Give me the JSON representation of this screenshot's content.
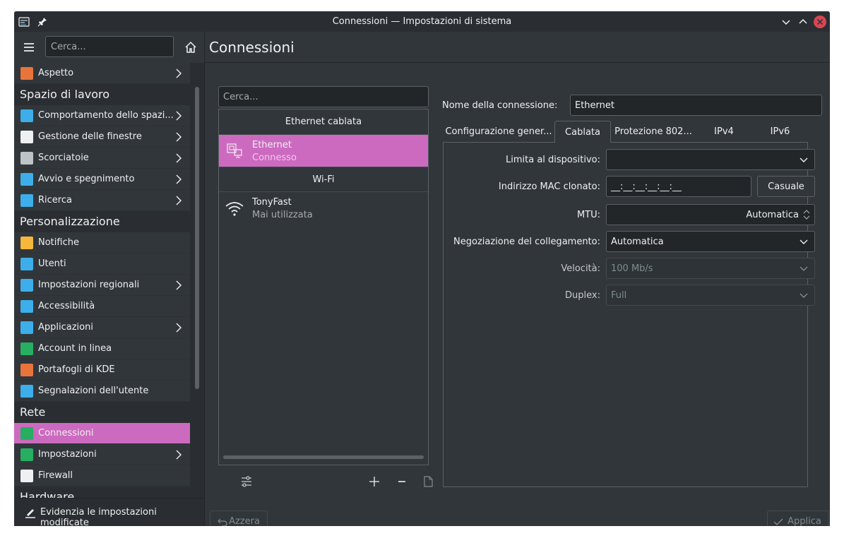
{
  "window": {
    "title": "Connessioni — Impostazioni di sistema"
  },
  "sidebar": {
    "search_placeholder": "Cerca...",
    "items": [
      {
        "type": "item",
        "label": "Aspetto",
        "icon": "appearance-icon",
        "color": "#e8743b",
        "chevron": true
      },
      {
        "type": "category",
        "label": "Spazio di lavoro"
      },
      {
        "type": "item",
        "label": "Comportamento dello spazi...",
        "icon": "workspace-behavior-icon",
        "color": "#3daee9",
        "chevron": true
      },
      {
        "type": "item",
        "label": "Gestione delle finestre",
        "icon": "window-management-icon",
        "color": "#eff0f1",
        "chevron": true
      },
      {
        "type": "item",
        "label": "Scorciatoie",
        "icon": "keyboard-icon",
        "color": "#bdc3c7",
        "chevron": true
      },
      {
        "type": "item",
        "label": "Avvio e spegnimento",
        "icon": "startup-icon",
        "color": "#3daee9",
        "chevron": true
      },
      {
        "type": "item",
        "label": "Ricerca",
        "icon": "search-icon",
        "color": "#3daee9",
        "chevron": true
      },
      {
        "type": "category",
        "label": "Personalizzazione"
      },
      {
        "type": "item",
        "label": "Notifiche",
        "icon": "bell-icon",
        "color": "#f6b73c",
        "chevron": false
      },
      {
        "type": "item",
        "label": "Utenti",
        "icon": "users-icon",
        "color": "#3daee9",
        "chevron": false
      },
      {
        "type": "item",
        "label": "Impostazioni regionali",
        "icon": "regional-icon",
        "color": "#3daee9",
        "chevron": true
      },
      {
        "type": "item",
        "label": "Accessibilità",
        "icon": "accessibility-icon",
        "color": "#3daee9",
        "chevron": false
      },
      {
        "type": "item",
        "label": "Applicazioni",
        "icon": "applications-icon",
        "color": "#3daee9",
        "chevron": true
      },
      {
        "type": "item",
        "label": "Account in linea",
        "icon": "globe-icon",
        "color": "#27ae60",
        "chevron": false
      },
      {
        "type": "item",
        "label": "Portafogli di KDE",
        "icon": "wallet-icon",
        "color": "#e8743b",
        "chevron": false
      },
      {
        "type": "item",
        "label": "Segnalazioni dell'utente",
        "icon": "feedback-icon",
        "color": "#3daee9",
        "chevron": false
      },
      {
        "type": "category",
        "label": "Rete"
      },
      {
        "type": "item",
        "label": "Connessioni",
        "icon": "globe-icon",
        "color": "#27ae60",
        "chevron": false,
        "selected": true
      },
      {
        "type": "item",
        "label": "Impostazioni",
        "icon": "globe-icon",
        "color": "#27ae60",
        "chevron": true
      },
      {
        "type": "item",
        "label": "Firewall",
        "icon": "shield-icon",
        "color": "#eff0f1",
        "chevron": false
      },
      {
        "type": "category",
        "label": "Hardware"
      }
    ],
    "footer_label": "Evidenzia le impostazioni modificate"
  },
  "main": {
    "page_title": "Connessioni",
    "search_placeholder": "Cerca...",
    "groups": [
      {
        "label": "Ethernet cablata",
        "connections": [
          {
            "name": "Ethernet",
            "status": "Connesso",
            "selected": true,
            "icon": "wired-network-icon"
          }
        ]
      },
      {
        "label": "Wi-Fi",
        "connections": [
          {
            "name": "TonyFast",
            "status": "Mai utilizzata",
            "selected": false,
            "icon": "wifi-icon"
          }
        ]
      }
    ],
    "connection_name_label": "Nome della connessione:",
    "connection_name_value": "Ethernet",
    "tabs": [
      "Configurazione gener...",
      "Cablata",
      "Protezione 802...",
      "IPv4",
      "IPv6"
    ],
    "active_tab": 1,
    "form": {
      "limit_device_label": "Limita al dispositivo:",
      "limit_device_value": "",
      "mac_label": "Indirizzo MAC clonato:",
      "mac_value": "__:__:__:__:__:__",
      "random_button": "Casuale",
      "mtu_label": "MTU:",
      "mtu_value": "Automatica",
      "negotiation_label": "Negoziazione del collegamento:",
      "negotiation_value": "Automatica",
      "speed_label": "Velocità:",
      "speed_value": "100 Mb/s",
      "duplex_label": "Duplex:",
      "duplex_value": "Full"
    },
    "reset_button": "Azzera",
    "apply_button": "Applica"
  }
}
